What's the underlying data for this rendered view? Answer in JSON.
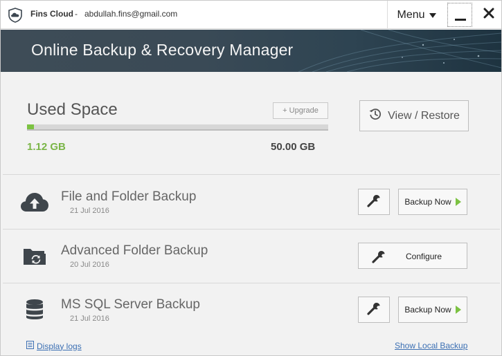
{
  "titlebar": {
    "app_name": "Fins Cloud",
    "separator": "-",
    "account_email": "abdullah.fins@gmail.com",
    "menu_label": "Menu",
    "icons": {
      "logo": "cloud-shield-icon",
      "menu_caret": "caret-down-icon",
      "minimize": "minimize-icon",
      "close": "close-icon"
    }
  },
  "banner": {
    "title": "Online Backup & Recovery Manager"
  },
  "space": {
    "title": "Used Space",
    "upgrade_label": "+ Upgrade",
    "used": "1.12 GB",
    "total": "50.00 GB",
    "used_fraction": 0.0224,
    "view_restore_label": "View / Restore",
    "colors": {
      "used": "#7ab547",
      "bar_fill": "#7cc242"
    }
  },
  "backups": [
    {
      "title": "File and Folder Backup",
      "date": "21 Jul 2016",
      "action_label": "Backup Now",
      "icon": "cloud-upload-icon"
    },
    {
      "title": "Advanced Folder Backup",
      "date": "20 Jul 2016",
      "action_label": "Configure",
      "icon": "folder-sync-icon"
    },
    {
      "title": "MS SQL Server Backup",
      "date": "21 Jul 2016",
      "action_label": "Backup Now",
      "icon": "database-icon"
    }
  ],
  "footer": {
    "display_logs_label": "Display logs",
    "show_local_backup_label": "Show Local Backup"
  }
}
